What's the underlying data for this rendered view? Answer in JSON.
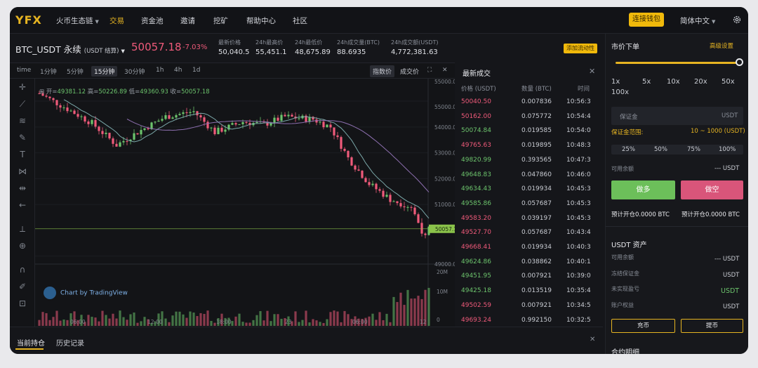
{
  "brand": "YFX",
  "nav": {
    "items": [
      {
        "label": "火币生态链",
        "dropdown": true
      },
      {
        "label": "交易",
        "active": true
      },
      {
        "label": "资金池"
      },
      {
        "label": "邀请"
      },
      {
        "label": "挖矿"
      },
      {
        "label": "帮助中心"
      },
      {
        "label": "社区"
      }
    ],
    "connect_wallet": "连接钱包",
    "language": "简体中文"
  },
  "ticker": {
    "symbol": "BTC_USDT 永续",
    "settle": "(USDT 结算)",
    "price": "50057.18",
    "change": "-7.03%",
    "stats": [
      {
        "label": "最新价格",
        "value": "50,040.5"
      },
      {
        "label": "24h最高价",
        "value": "55,451.1"
      },
      {
        "label": "24h最低价",
        "value": "48,675.89"
      },
      {
        "label": "24h成交量(BTC)",
        "value": "88.6935"
      },
      {
        "label": "24h成交额(USDT)",
        "value": "4,772,381.63"
      }
    ],
    "add_liquidity": "添加流动性"
  },
  "chart": {
    "timeframes": [
      "time",
      "1分钟",
      "5分钟",
      "15分钟",
      "30分钟",
      "1h",
      "4h",
      "1d"
    ],
    "selected_timeframe": "15分钟",
    "price_modes": [
      "指数价",
      "成交价"
    ],
    "ohlc": {
      "open_label": "开=",
      "open": "49381.12",
      "high_label": "高=",
      "high": "50226.89",
      "low_label": "低=",
      "low": "49360.93",
      "close_label": "收=",
      "close": "50057.18"
    },
    "price_axis": [
      "55000.00",
      "55000.00",
      "54000.00",
      "53000.00",
      "52000.00",
      "51000.00",
      "50057.18",
      "49000.00"
    ],
    "volume_axis": [
      "20M",
      "10M",
      "0"
    ],
    "time_axis": [
      "06:00",
      "12:00",
      "18:00",
      "23",
      "06:00",
      "12"
    ],
    "credit": "Chart by TradingView",
    "colors": {
      "up": "#6cc36c",
      "down": "#ef5a7a",
      "last": "#8bc34a"
    }
  },
  "trades": {
    "title": "最新成交",
    "columns": [
      "价格 (USDT)",
      "数量 (BTC)",
      "时间"
    ],
    "rows": [
      {
        "price": "50040.50",
        "qty": "0.007836",
        "time": "10:56:3",
        "side": "down"
      },
      {
        "price": "50162.00",
        "qty": "0.075772",
        "time": "10:54:4",
        "side": "down"
      },
      {
        "price": "50074.84",
        "qty": "0.019585",
        "time": "10:54:0",
        "side": "up"
      },
      {
        "price": "49765.63",
        "qty": "0.019895",
        "time": "10:48:3",
        "side": "down"
      },
      {
        "price": "49820.99",
        "qty": "0.393565",
        "time": "10:47:3",
        "side": "up"
      },
      {
        "price": "49648.83",
        "qty": "0.047860",
        "time": "10:46:0",
        "side": "up"
      },
      {
        "price": "49634.43",
        "qty": "0.019934",
        "time": "10:45:3",
        "side": "up"
      },
      {
        "price": "49585.86",
        "qty": "0.057687",
        "time": "10:45:3",
        "side": "up"
      },
      {
        "price": "49583.20",
        "qty": "0.039197",
        "time": "10:45:3",
        "side": "down"
      },
      {
        "price": "49527.70",
        "qty": "0.057687",
        "time": "10:43:4",
        "side": "down"
      },
      {
        "price": "49668.41",
        "qty": "0.019934",
        "time": "10:40:3",
        "side": "down"
      },
      {
        "price": "49624.86",
        "qty": "0.038862",
        "time": "10:40:1",
        "side": "up"
      },
      {
        "price": "49451.95",
        "qty": "0.007921",
        "time": "10:39:0",
        "side": "up"
      },
      {
        "price": "49425.18",
        "qty": "0.013519",
        "time": "10:35:4",
        "side": "up"
      },
      {
        "price": "49502.59",
        "qty": "0.007921",
        "time": "10:34:5",
        "side": "down"
      },
      {
        "price": "49693.24",
        "qty": "0.992150",
        "time": "10:32:5",
        "side": "down"
      }
    ]
  },
  "order": {
    "title": "市价下单",
    "advanced": "高级设置",
    "leverage_value": 1,
    "leverage_max": 100,
    "leverage": [
      "1x",
      "5x",
      "10x",
      "20x",
      "50x",
      "100x"
    ],
    "margin_placeholder": "保证金",
    "margin_unit": "USDT",
    "margin_range_label": "保证金范围:",
    "margin_range": "10 ~ 1000 (USDT)",
    "pct": [
      "25%",
      "50%",
      "75%",
      "100%"
    ],
    "available_label": "可用余额",
    "available": "--- USDT",
    "long": "做多",
    "short": "做空",
    "est_long": "预计开仓0.0000 BTC",
    "est_short": "预计开仓0.0000 BTC"
  },
  "assets": {
    "title": "USDT 资产",
    "rows": [
      {
        "label": "可用余额",
        "value": "--- USDT"
      },
      {
        "label": "冻结保证金",
        "value": "USDT"
      },
      {
        "label": "未实现盈亏",
        "value": "USDT"
      },
      {
        "label": "账户权益",
        "value": "USDT"
      }
    ],
    "deposit": "充币",
    "withdraw": "提币",
    "contract": "合约明细"
  },
  "bottom": {
    "tabs": [
      "当前持仓",
      "历史记录"
    ]
  }
}
